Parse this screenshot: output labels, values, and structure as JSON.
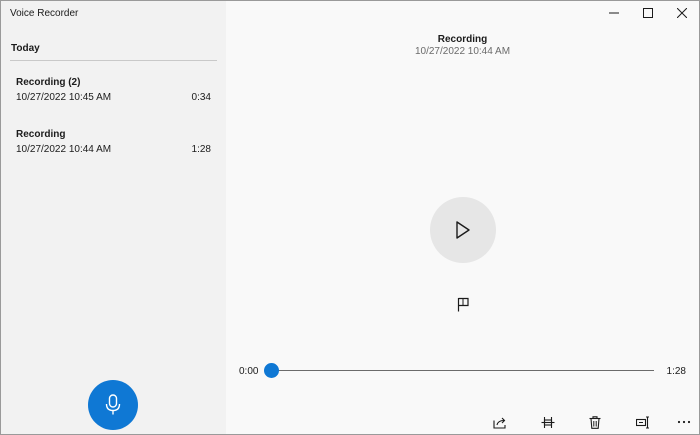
{
  "app": {
    "title": "Voice Recorder"
  },
  "sidebar": {
    "section_header": "Today",
    "recordings": [
      {
        "name": "Recording (2)",
        "date": "10/27/2022 10:45 AM",
        "duration": "0:34"
      },
      {
        "name": "Recording",
        "date": "10/27/2022 10:44 AM",
        "duration": "1:28"
      }
    ],
    "record_button_icon": "microphone-icon"
  },
  "player": {
    "title": "Recording",
    "date": "10/27/2022 10:44 AM",
    "current_time": "0:00",
    "total_time": "1:28",
    "progress": 0,
    "play_icon": "play-icon",
    "marker_icon": "flag-icon"
  },
  "toolbar": {
    "icons": [
      "share-icon",
      "trim-icon",
      "delete-icon",
      "rename-icon",
      "more-icon"
    ]
  },
  "window_controls": {
    "icons": [
      "minimize-icon",
      "maximize-icon",
      "close-icon"
    ]
  },
  "colors": {
    "accent": "#0f78d4",
    "sidebar_bg": "#f2f2f2",
    "main_bg": "#f9f9f9",
    "play_button_bg": "#e6e6e6"
  }
}
